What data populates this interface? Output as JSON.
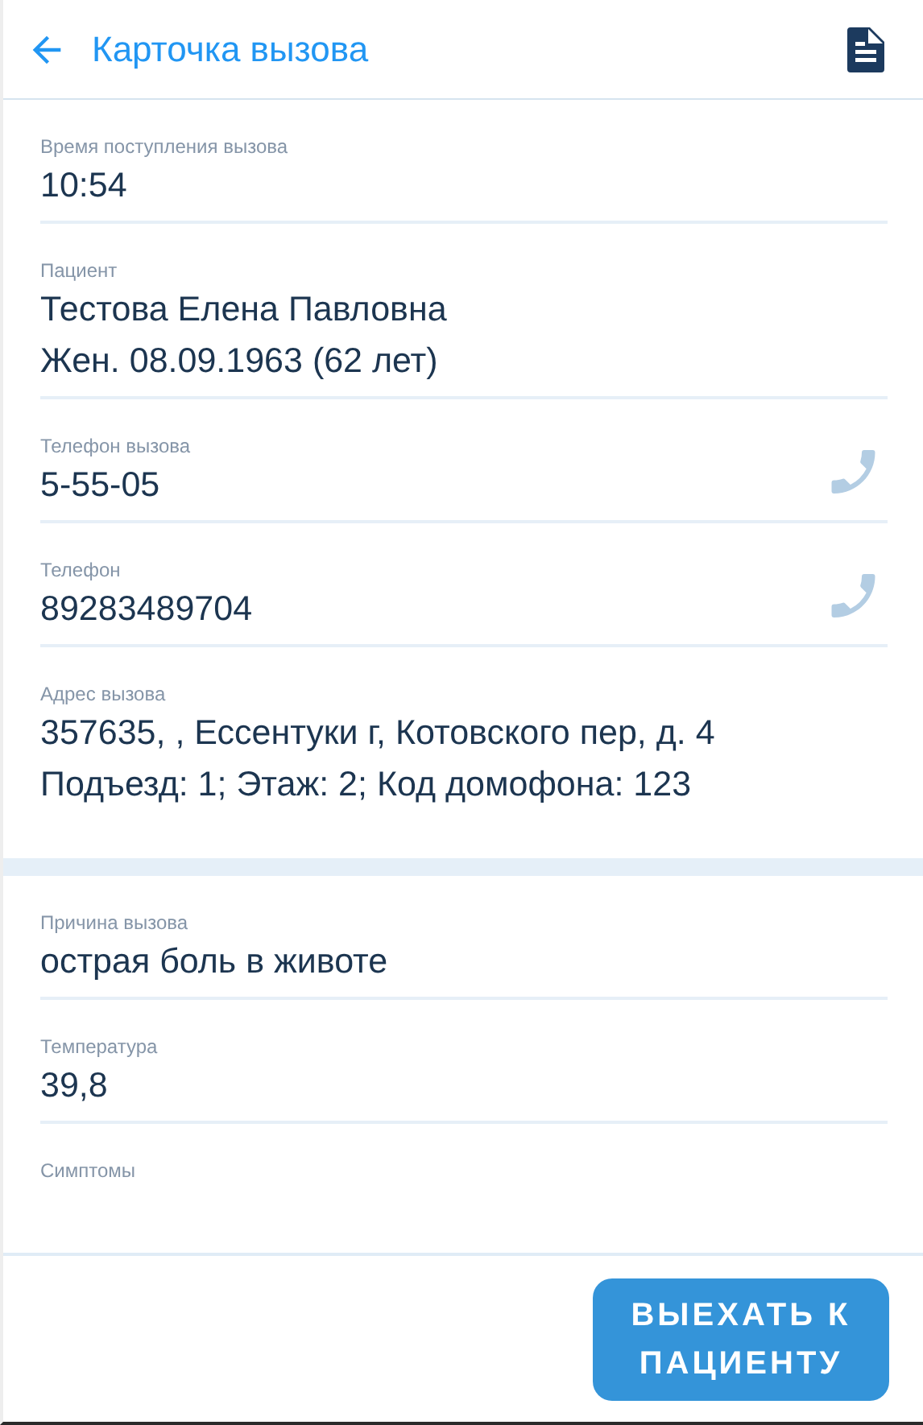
{
  "header": {
    "title": "Карточка вызова"
  },
  "sections": [
    {
      "fields": [
        {
          "label": "Время поступления вызова",
          "lines": [
            "10:54"
          ]
        },
        {
          "label": "Пациент",
          "lines": [
            "Тестова Елена Павловна",
            "Жен. 08.09.1963 (62 лет)"
          ]
        },
        {
          "label": "Телефон вызова",
          "lines": [
            "5-55-05"
          ],
          "kind": "phone"
        },
        {
          "label": "Телефон",
          "lines": [
            "89283489704"
          ],
          "kind": "phone"
        },
        {
          "label": "Адрес вызова",
          "lines": [
            "357635, , Ессентуки г, Котовского пер, д. 4",
            "Подъезд: 1; Этаж: 2; Код домофона: 123"
          ],
          "kind": "last"
        }
      ]
    },
    {
      "fields": [
        {
          "label": "Причина вызова",
          "lines": [
            "острая боль в животе"
          ]
        },
        {
          "label": "Температура",
          "lines": [
            "39,8"
          ]
        },
        {
          "label": "Симптомы",
          "kind": "last"
        }
      ]
    }
  ],
  "action_button": "ВЫЕХАТЬ К ПАЦИЕНТУ"
}
